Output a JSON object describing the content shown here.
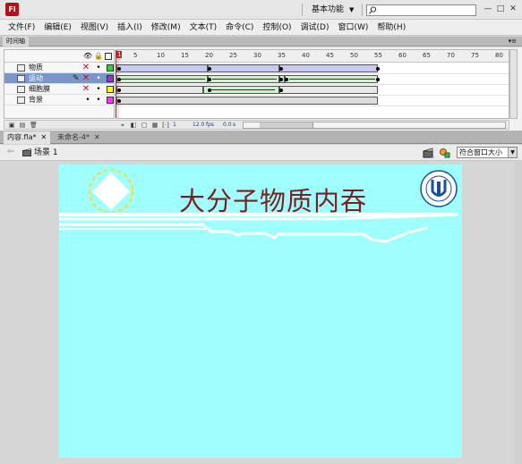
{
  "app": {
    "logo": "Fl",
    "workspace": "基本功能"
  },
  "window_controls": [
    "—",
    "□",
    "✕"
  ],
  "menu": [
    "文件(F)",
    "编辑(E)",
    "视图(V)",
    "插入(I)",
    "修改(M)",
    "文本(T)",
    "命令(C)",
    "控制(O)",
    "调试(D)",
    "窗口(W)",
    "帮助(H)"
  ],
  "timeline": {
    "tab_label": "时间轴",
    "ruler": [
      "1",
      "5",
      "10",
      "15",
      "20",
      "25",
      "30",
      "35",
      "40",
      "45",
      "50",
      "55",
      "60",
      "65",
      "70",
      "75",
      "80"
    ],
    "layers": [
      {
        "name": "物质",
        "selected": false,
        "color": "#33cc33"
      },
      {
        "name": "运动",
        "selected": true,
        "color": "#9933cc"
      },
      {
        "name": "细胞膜",
        "selected": false,
        "color": "#ffff00"
      },
      {
        "name": "背景",
        "selected": false,
        "color": "#ff33ff"
      }
    ],
    "current_frame": "1",
    "fps": "12.0",
    "fps_unit": "fps",
    "time": "0.0",
    "time_unit": "s"
  },
  "doc_tabs": [
    {
      "label": "内容.fla*",
      "active": true
    },
    {
      "label": "未命名-4*",
      "active": false
    }
  ],
  "editbar": {
    "scene": "场景 1",
    "zoom": "符合窗口大小"
  },
  "stage": {
    "title": "大分子物质内吞",
    "background": "#9ffffe"
  }
}
